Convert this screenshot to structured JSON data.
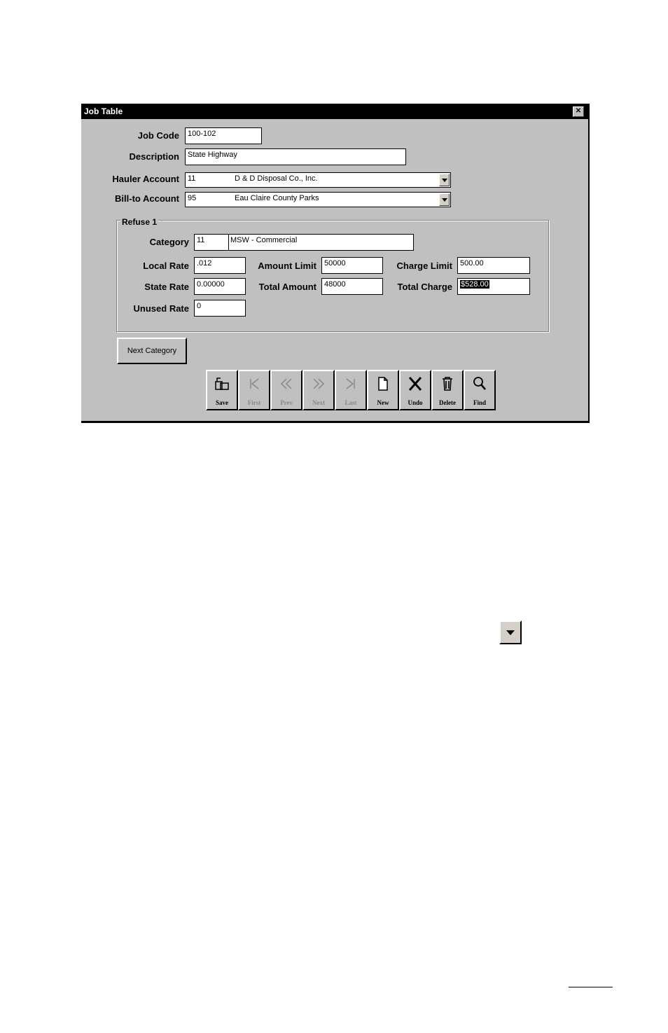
{
  "window": {
    "title": "Job Table",
    "close_icon": "close-icon"
  },
  "form": {
    "job_code": {
      "label": "Job Code",
      "value": "100-102"
    },
    "description": {
      "label": "Description",
      "value": "State Highway"
    },
    "hauler_account": {
      "label": "Hauler Account",
      "code": "11",
      "name": "D & D Disposal Co., Inc."
    },
    "billto_account": {
      "label": "Bill-to Account",
      "code": "95",
      "name": "Eau Claire County Parks"
    }
  },
  "refuse": {
    "group_label": "Refuse 1",
    "category": {
      "label": "Category",
      "code": "11",
      "name": "MSW - Commercial"
    },
    "local_rate": {
      "label": "Local Rate",
      "value": ".012"
    },
    "state_rate": {
      "label": "State Rate",
      "value": "0.00000"
    },
    "unused_rate": {
      "label": "Unused Rate",
      "value": "0"
    },
    "amount_limit": {
      "label": "Amount Limit",
      "value": "50000"
    },
    "total_amount": {
      "label": "Total Amount",
      "value": "48000"
    },
    "charge_limit": {
      "label": "Charge Limit",
      "value": "500.00"
    },
    "total_charge": {
      "label": "Total Charge",
      "value": "$528.00"
    }
  },
  "next_category_button": "Next Category",
  "toolbar": {
    "items": [
      {
        "label": "Save",
        "icon": "save-icon",
        "enabled": true
      },
      {
        "label": "First",
        "icon": "first-icon",
        "enabled": false
      },
      {
        "label": "Prev",
        "icon": "prev-icon",
        "enabled": false
      },
      {
        "label": "Next",
        "icon": "next-icon",
        "enabled": false
      },
      {
        "label": "Last",
        "icon": "last-icon",
        "enabled": false
      },
      {
        "label": "New",
        "icon": "new-icon",
        "enabled": true
      },
      {
        "label": "Undo",
        "icon": "undo-icon",
        "enabled": true
      },
      {
        "label": "Delete",
        "icon": "delete-icon",
        "enabled": true
      },
      {
        "label": "Find",
        "icon": "find-icon",
        "enabled": true
      }
    ]
  }
}
